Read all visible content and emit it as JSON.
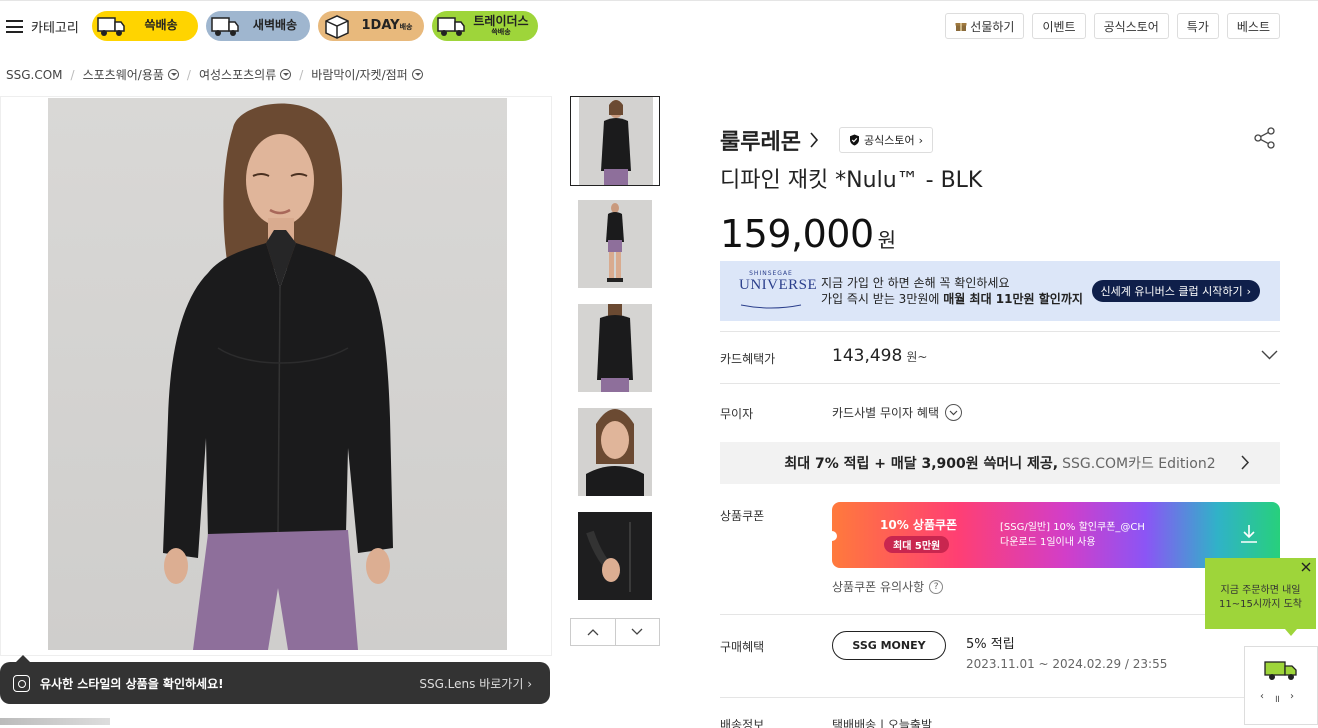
{
  "header": {
    "category_label": "카테고리",
    "services": [
      {
        "label": "쓱배송",
        "sub": ""
      },
      {
        "label": "새벽배송",
        "sub": ""
      },
      {
        "label": "1DAY",
        "sub": "배송"
      },
      {
        "label": "트레이더스",
        "sub": "쓱배송"
      }
    ],
    "links": [
      "선물하기",
      "이벤트",
      "공식스토어",
      "특가",
      "베스트"
    ]
  },
  "breadcrumb": [
    "SSG.COM",
    "스포츠웨어/용품",
    "여성스포츠의류",
    "바람막이/자켓/점퍼"
  ],
  "lens_banner": {
    "text": "유사한 스타일의 상품을 확인하세요!",
    "link": "SSG.Lens 바로가기"
  },
  "product": {
    "brand": "룰루레몬",
    "official_badge": "공식스토어",
    "title": "디파인 재킷 *Nulu™ - BLK",
    "price": "159,000",
    "price_unit": "원"
  },
  "universe": {
    "logo_small": "SHINSEGAE",
    "logo_big": "UNIVERSE",
    "line1": "지금 가입 안 하면 손해 꼭 확인하세요",
    "line2_prefix": "가입 즉시 받는 3만원에 ",
    "line2_bold": "매월 최대 11만원 할인까지",
    "button": "신세계 유니버스 클럽 시작하기"
  },
  "card_benefit": {
    "label": "카드혜택가",
    "price": "143,498",
    "unit": "원~"
  },
  "installment": {
    "label": "무이자",
    "value": "카드사별 무이자 혜택"
  },
  "ssg_card": {
    "main": "최대 7% 적립 + 매달 3,900원 쓱머니 제공,",
    "sub": "SSG.COM카드 Edition2"
  },
  "coupon": {
    "label": "상품쿠폰",
    "percent": "10% 상품쿠폰",
    "max": "최대 5만원",
    "desc1": "[SSG/일반] 10% 할인쿠폰_@CH",
    "desc2": "다운로드 1일이내 사용",
    "note": "상품쿠폰 유의사항",
    "note_icon": "?"
  },
  "purchase_benefit": {
    "label": "구매혜택",
    "badge": "SSG MONEY",
    "reward": "5% 적립",
    "period": "2023.11.01 ~ 2024.02.29 / 23:55"
  },
  "cut_row": {
    "label": "배송정보",
    "value": "택배배송 | 오늘출발"
  },
  "delivery_tooltip": {
    "line1": "지금 주문하면 내일",
    "line2": "11~15시까지 도착"
  },
  "colors": {
    "ssg_yellow": "#ffd400",
    "dawn_blue": "#9fb6cf",
    "oneday_tan": "#e8b97c",
    "traders_green": "#9ed53a",
    "universe_bg": "#dce6f8",
    "universe_btn": "#0f1f4a"
  },
  "icons": [
    "hamburger-icon",
    "truck-icon",
    "gift-icon",
    "chevron-down-icon",
    "share-icon",
    "shield-check-icon",
    "download-icon",
    "close-icon",
    "lens-icon"
  ]
}
